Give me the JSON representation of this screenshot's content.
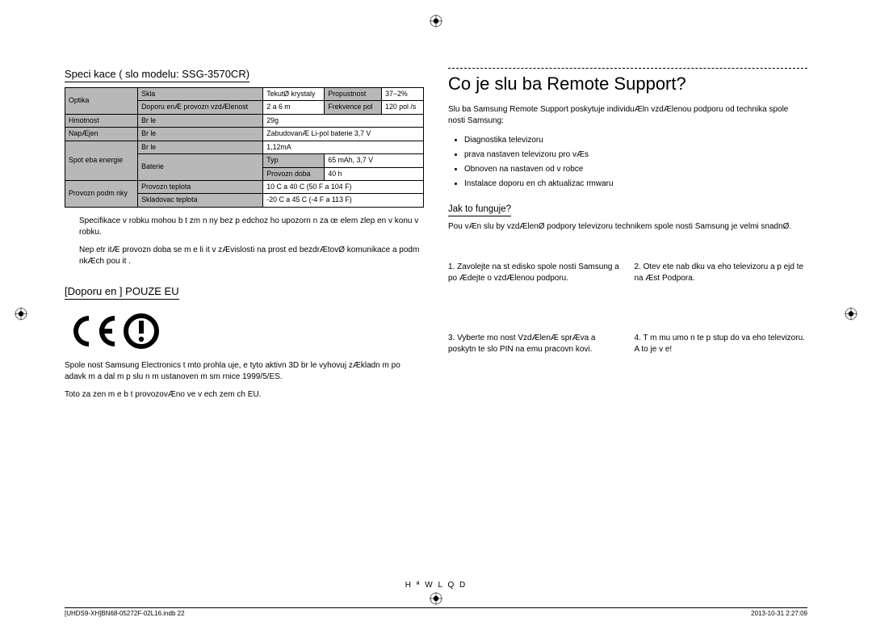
{
  "left": {
    "spec_title": "Speci kace (  slo modelu: SSG-3570CR)",
    "table": {
      "optika": "Optika",
      "skla": "Skla",
      "skla_val": "TekutØ krystaly",
      "propustnost": "Propustnost",
      "propustnost_val": "37−2%",
      "dop_vzd": "Doporu enÆ provozn  vzdÆlenost",
      "dop_vzd_val": "2 a  6 m",
      "frekvence": "Frekvence pol",
      "frekvence_val": "120 pol /s",
      "hmotnost": "Hmotnost",
      "bryle": "Br le",
      "hmotnost_val": "29g",
      "napajeni": "NapÆjen",
      "napajeni_val": "ZabudovanÆ Li-pol baterie 3,7 V",
      "spotreba": "Spot eba energie",
      "spotreba_bryle_val": "1,12mA",
      "baterie": "Baterie",
      "typ": "Typ",
      "typ_val": "65 mAh, 3,7 V",
      "provozni_doba": "Provozn  doba",
      "provozni_doba_val": "40 h",
      "provozni_podminky": "Provozn  podm nky",
      "provozni_teplota": "Provozn  teplota",
      "provozni_teplota_val": "10  C a  40  C (50 F a  104 F)",
      "skladovaci_teplota": "Skladovac  teplota",
      "skladovaci_teplota_val": "-20  C a  45  C (-4 F a  113 F)"
    },
    "note1": "Specifikace v robku mohou b t zm n ny bez p edchoz ho upozorn n  za œ elem zlep en  v konu v robku.",
    "note2": "Nep etr itÆ provozn  doba se m  e li it v zÆvislosti na prost ed  bezdrÆtovØ komunikace a podm nkÆch pou it .",
    "eu_title": "[Doporu en ]   POUZE EU",
    "eu_text1": "Spole nost Samsung Electronics t mto prohla uje,  e tyto aktivn  3D br le vyhovuj  zÆkladn m po adavk m a dal  m p  slu n m ustanoven m sm rnice 1999/5/ES.",
    "eu_text2": "Toto za  zen  m  e b t provozovÆno ve v ech zem ch EU."
  },
  "right": {
    "heading": "Co je slu ba Remote Support?",
    "intro": "Slu ba Samsung Remote Support poskytuje individuÆln  vzdÆlenou podporu od technika spole nosti Samsung:",
    "bullets": [
      "Diagnostika televizoru",
      " prava nastaven  televizoru pro vÆs",
      "Obnoven  na nastaven  od v robce",
      "Instalace doporu en ch aktualizac   rmwaru"
    ],
    "how_title": "Jak to funguje?",
    "how_text": "Pou  vÆn  slu by vzdÆlenØ podpory televizoru technikem spole nosti Samsung je velmi snadnØ.",
    "steps": {
      "s1": "1.   Zavolejte na st edisko spole nosti Samsung a po Ædejte o vzdÆlenou podporu.",
      "s2": "2.   Otev ete nab dku va eho televizoru a p ejd te na  Æst Podpora.",
      "s3": "3.   Vyberte mo nost VzdÆlenÆ sprÆva a poskytn te   slo PIN na emu pracovn kovi.",
      "s4": "4.   T m mu umo n te p  stup do va eho televizoru. A to je v e!"
    }
  },
  "footer": {
    "center": "H ª W L Q D",
    "leftf": "[UHDS9-XH]BN68-05272F-02L16.indb   22",
    "rightf": "2013-10-31    2:27:09"
  }
}
